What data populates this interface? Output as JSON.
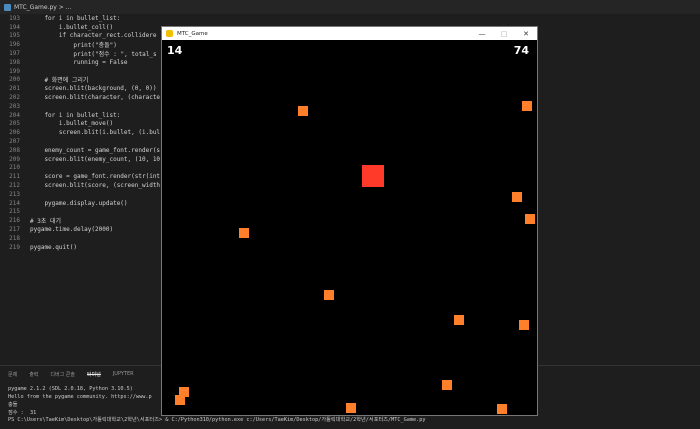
{
  "editor": {
    "tab_label": "MTC_Game.py > ...",
    "lines": [
      {
        "n": "193",
        "t": "    for i in bullet_list:"
      },
      {
        "n": "194",
        "t": "        i.bullet_coll()"
      },
      {
        "n": "195",
        "t": "        if character_rect.collidere"
      },
      {
        "n": "196",
        "t": "            print(\"충돌\")"
      },
      {
        "n": "197",
        "t": "            print(\"점수 : \", total_s"
      },
      {
        "n": "198",
        "t": "            running = False"
      },
      {
        "n": "199",
        "t": ""
      },
      {
        "n": "200",
        "t": "    # 화면에 그리기"
      },
      {
        "n": "201",
        "t": "    screen.blit(background, (0, 0))"
      },
      {
        "n": "202",
        "t": "    screen.blit(character, (characte"
      },
      {
        "n": "203",
        "t": ""
      },
      {
        "n": "204",
        "t": "    for i in bullet_list:"
      },
      {
        "n": "205",
        "t": "        i.bullet_move()"
      },
      {
        "n": "206",
        "t": "        screen.blit(i.bullet, (i.bul"
      },
      {
        "n": "207",
        "t": ""
      },
      {
        "n": "208",
        "t": "    enemy_count = game_font.render(s"
      },
      {
        "n": "209",
        "t": "    screen.blit(enemy_count, (10, 10"
      },
      {
        "n": "210",
        "t": ""
      },
      {
        "n": "211",
        "t": "    score = game_font.render(str(int"
      },
      {
        "n": "212",
        "t": "    screen.blit(score, (screen_width"
      },
      {
        "n": "213",
        "t": ""
      },
      {
        "n": "214",
        "t": "    pygame.display.update()"
      },
      {
        "n": "215",
        "t": ""
      },
      {
        "n": "216",
        "t": "# 3초 대기"
      },
      {
        "n": "217",
        "t": "pygame.time.delay(2000)"
      },
      {
        "n": "218",
        "t": ""
      },
      {
        "n": "219",
        "t": "pygame.quit()"
      }
    ]
  },
  "panel": {
    "tabs": [
      "문제",
      "출력",
      "디버그 콘솔",
      "터미널",
      "JUPYTER"
    ],
    "active_tab": "터미널",
    "terminal": [
      "pygame 2.1.2 (SDL 2.0.18, Python 3.10.5)",
      "Hello from the pygame community. https://www.p",
      "충돌",
      "점수 :  31",
      "PS C:\\Users\\TaeKim\\Desktop\\가톨릭대학교\\2학년\\서포터즈> & C:/Python310/python.exe c:/Users/TaeKim/Desktop/가톨릭대학교/2학년/서포터즈/MTC_Game.py"
    ]
  },
  "game": {
    "window_title": "MTC_Game",
    "minimize": "—",
    "maximize": "□",
    "close": "✕",
    "enemy_count": "14",
    "score": "74",
    "character_color": "#ff3a28",
    "bullet_color": "#ff7f2a"
  }
}
